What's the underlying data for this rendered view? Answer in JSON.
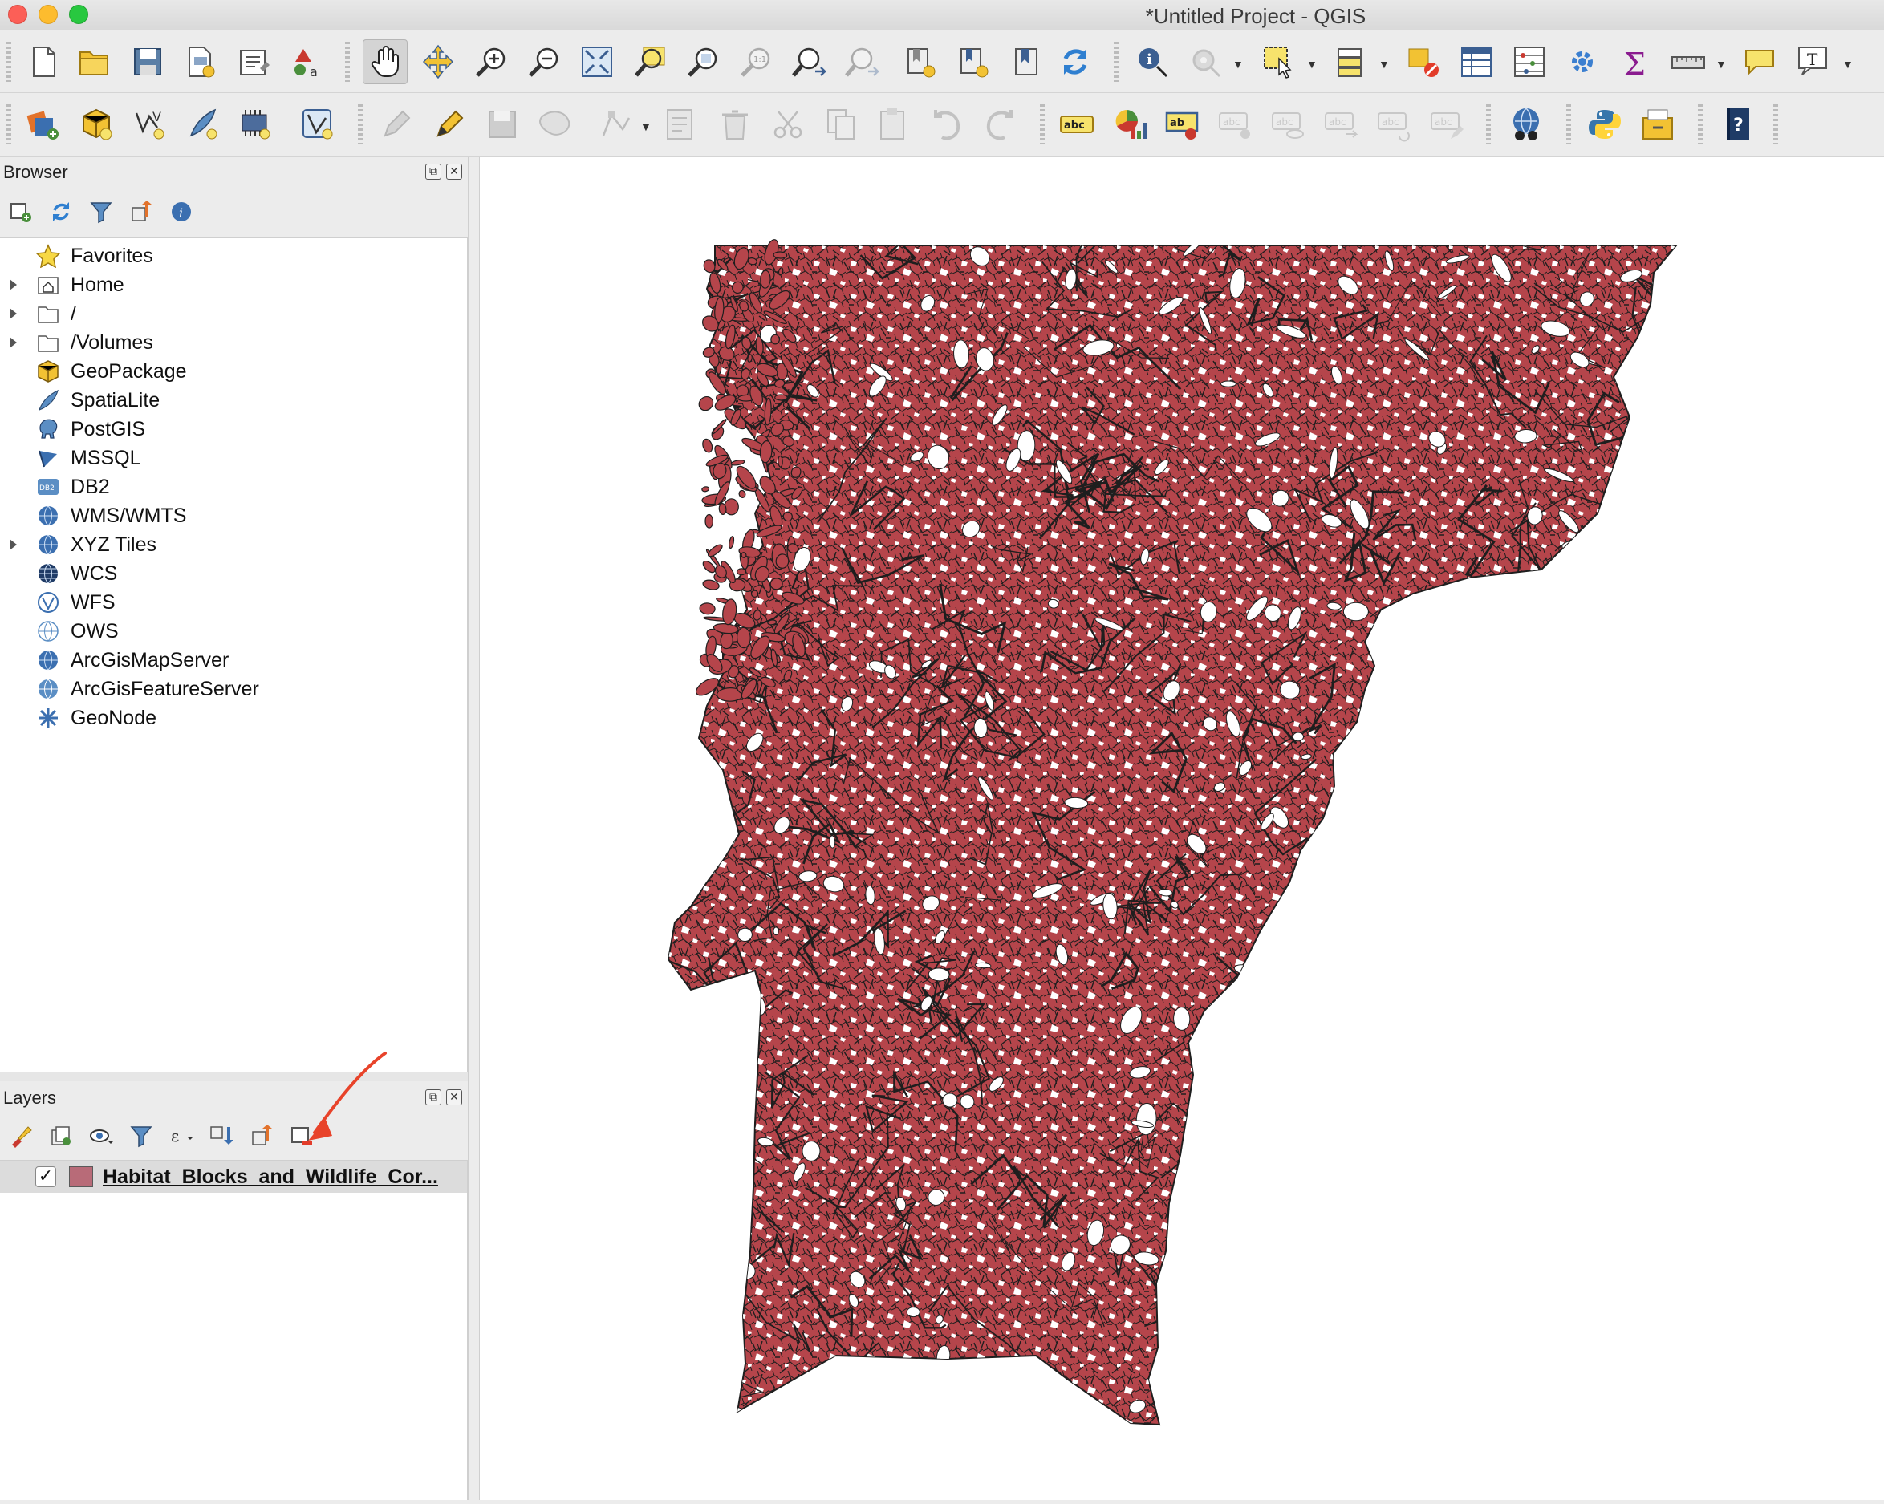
{
  "app": {
    "title": "*Untitled Project - QGIS"
  },
  "toolbar1": {
    "tools": [
      "new-project-icon",
      "open-project-icon",
      "save-project-icon",
      "save-as-icon",
      "print-layout-icon",
      "style-manager-icon",
      "pan-icon",
      "pan-to-selection-icon",
      "zoom-in-icon",
      "zoom-out-icon",
      "zoom-full-icon",
      "zoom-to-selection-icon",
      "zoom-to-layer-icon",
      "zoom-native-icon",
      "zoom-last-icon",
      "zoom-next-icon",
      "new-bookmark-icon",
      "show-bookmarks-icon",
      "show-spatial-bookmarks-icon",
      "refresh-icon",
      "identify-icon",
      "run-action-icon",
      "select-features-icon",
      "select-by-value-icon",
      "deselect-icon",
      "open-attribute-table-icon",
      "statistics-icon",
      "processing-toolbox-icon",
      "field-calculator-icon",
      "measure-icon",
      "map-tips-icon",
      "text-annotation-icon"
    ]
  },
  "browser": {
    "title": "Browser",
    "items": [
      {
        "label": "Favorites",
        "icon": "star-icon",
        "expandable": false
      },
      {
        "label": "Home",
        "icon": "home-folder-icon",
        "expandable": true
      },
      {
        "label": "/",
        "icon": "folder-icon",
        "expandable": true
      },
      {
        "label": "/Volumes",
        "icon": "folder-icon",
        "expandable": true
      },
      {
        "label": "GeoPackage",
        "icon": "geopackage-icon",
        "expandable": false
      },
      {
        "label": "SpatiaLite",
        "icon": "spatialite-icon",
        "expandable": false
      },
      {
        "label": "PostGIS",
        "icon": "postgis-icon",
        "expandable": false
      },
      {
        "label": "MSSQL",
        "icon": "mssql-icon",
        "expandable": false
      },
      {
        "label": "DB2",
        "icon": "db2-icon",
        "expandable": false
      },
      {
        "label": "WMS/WMTS",
        "icon": "wms-globe-icon",
        "expandable": false
      },
      {
        "label": "XYZ Tiles",
        "icon": "xyz-globe-icon",
        "expandable": true
      },
      {
        "label": "WCS",
        "icon": "wcs-globe-icon",
        "expandable": false
      },
      {
        "label": "WFS",
        "icon": "wfs-globe-icon",
        "expandable": false
      },
      {
        "label": "OWS",
        "icon": "ows-globe-icon",
        "expandable": false
      },
      {
        "label": "ArcGisMapServer",
        "icon": "arcgis-map-icon",
        "expandable": false
      },
      {
        "label": "ArcGisFeatureServer",
        "icon": "arcgis-feature-icon",
        "expandable": false
      },
      {
        "label": "GeoNode",
        "icon": "geonode-icon",
        "expandable": false
      }
    ]
  },
  "layers": {
    "title": "Layers",
    "items": [
      {
        "name": "Habitat_Blocks_and_Wildlife_Cor...",
        "checked": true,
        "swatch_color": "#b86b78"
      }
    ]
  },
  "map": {
    "fill_color": "#b5454b",
    "stroke_color": "#1e1e1e"
  },
  "annotation": {
    "arrow_color": "#e8432a"
  }
}
